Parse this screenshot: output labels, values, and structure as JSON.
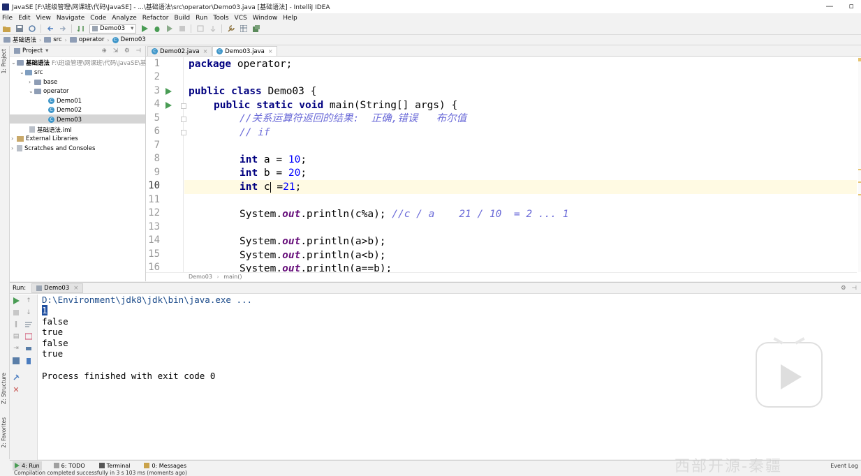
{
  "window": {
    "title": "JavaSE [F:\\班级管理\\网课班\\代码\\JavaSE] - ...\\基础语法\\src\\operator\\Demo03.java [基础语法] - IntelliJ IDEA",
    "minimize": "—",
    "maximize": "▫"
  },
  "menu": [
    "File",
    "Edit",
    "View",
    "Navigate",
    "Code",
    "Analyze",
    "Refactor",
    "Build",
    "Run",
    "Tools",
    "VCS",
    "Window",
    "Help"
  ],
  "toolbar": {
    "run_config": "Demo03",
    "dropdown": "▾"
  },
  "breadcrumbs": [
    "基础语法",
    "src",
    "operator",
    "Demo03"
  ],
  "side_tabs": {
    "project": "1: Project",
    "structure": "Z: Structure",
    "favorites": "2: Favorites"
  },
  "project": {
    "header": "Project",
    "tree": {
      "root": "基础语法",
      "root_path": "F:\\班级管理\\网课班\\代码\\JavaSE\\基础语",
      "src": "src",
      "base": "base",
      "operator": "operator",
      "demo01": "Demo01",
      "demo02": "Demo02",
      "demo03": "Demo03",
      "iml": "基础语法.iml",
      "external": "External Libraries",
      "scratches": "Scratches and Consoles"
    }
  },
  "editor": {
    "tabs": [
      {
        "label": "Demo02.java",
        "active": false
      },
      {
        "label": "Demo03.java",
        "active": true
      }
    ],
    "line_numbers": [
      "1",
      "2",
      "3",
      "4",
      "5",
      "6",
      "7",
      "8",
      "9",
      "10",
      "11",
      "12",
      "13",
      "14",
      "15",
      "16"
    ],
    "code": {
      "l1_kw": "package",
      "l1_rest": " operator;",
      "l3_kw1": "public",
      "l3_kw2": "class",
      "l3_rest": " Demo03 {",
      "l4_kw1": "public",
      "l4_kw2": "static",
      "l4_kw3": "void",
      "l4_rest": " main(String[] args) {",
      "l5_comment": "//关系运算符返回的结果:  正确,错误   布尔值",
      "l6_comment": "// if",
      "l8_kw": "int",
      "l8_rest": " a = ",
      "l8_num": "10",
      "l8_end": ";",
      "l9_kw": "int",
      "l9_rest": " b = ",
      "l9_num": "20",
      "l9_end": ";",
      "l10_kw": "int",
      "l10_pre": " c",
      "l10_rest": " =",
      "l10_num": "21",
      "l10_end": ";",
      "l12_pre": "System.",
      "l12_field": "out",
      "l12_post": ".println(c%a); ",
      "l12_comment": "//c / a    21 / 10  = 2 ... 1",
      "l14_pre": "System.",
      "l14_field": "out",
      "l14_post": ".println(a>b);",
      "l15_pre": "System.",
      "l15_field": "out",
      "l15_post": ".println(a<b);",
      "l16_pre": "System.",
      "l16_field": "out",
      "l16_post": ".println(a==b);"
    },
    "breadcrumb": [
      "Demo03",
      "main()"
    ]
  },
  "run": {
    "label": "Run:",
    "tab": "Demo03",
    "console": {
      "command": "D:\\Environment\\jdk8\\jdk\\bin\\java.exe ...",
      "line1": "1",
      "line2": "false",
      "line3": "true",
      "line4": "false",
      "line5": "true",
      "finish": "Process finished with exit code 0"
    }
  },
  "bottom_tools": [
    "4: Run",
    "6: TODO",
    "Terminal",
    "0: Messages"
  ],
  "event_log": "Event Log",
  "status": "Compilation completed successfully in 3 s 103 ms (moments ago)",
  "watermark_text": "西部开源-秦疆"
}
